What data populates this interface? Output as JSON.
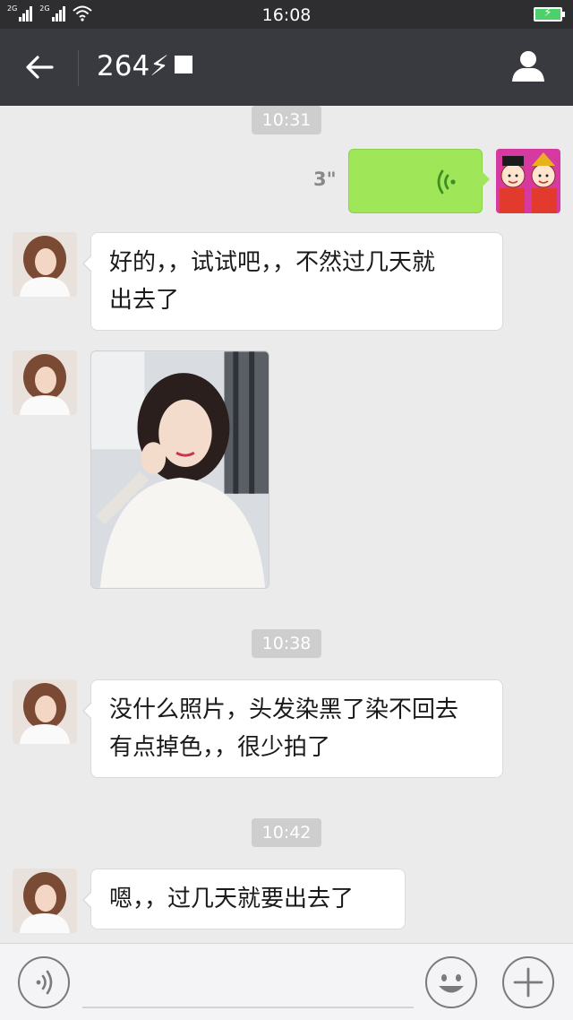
{
  "status_bar": {
    "network_1": "2G",
    "network_2": "2G",
    "time": "16:08"
  },
  "header": {
    "title": "264⚡"
  },
  "messages": {
    "ts1": "10:31",
    "voice_duration": "3\"",
    "msg1_line1": "好的，，试试吧，，不然过几天就",
    "msg1_line2": "出去了",
    "ts2": "10:38",
    "msg2_line1": "没什么照片，头发染黑了染不回去",
    "msg2_line2": "有点掉色，，很少拍了",
    "ts3": "10:42",
    "msg3_line1": "嗯，，过几天就要出去了"
  },
  "icons": {
    "back": "back-arrow-icon",
    "profile": "person-icon",
    "voice_toggle": "voice-icon",
    "emoji": "emoji-icon",
    "more": "plus-icon"
  },
  "colors": {
    "header_bg": "#393a3f",
    "chat_bg": "#ebebeb",
    "voice_bubble": "#9fe659",
    "battery": "#4bd06a"
  }
}
